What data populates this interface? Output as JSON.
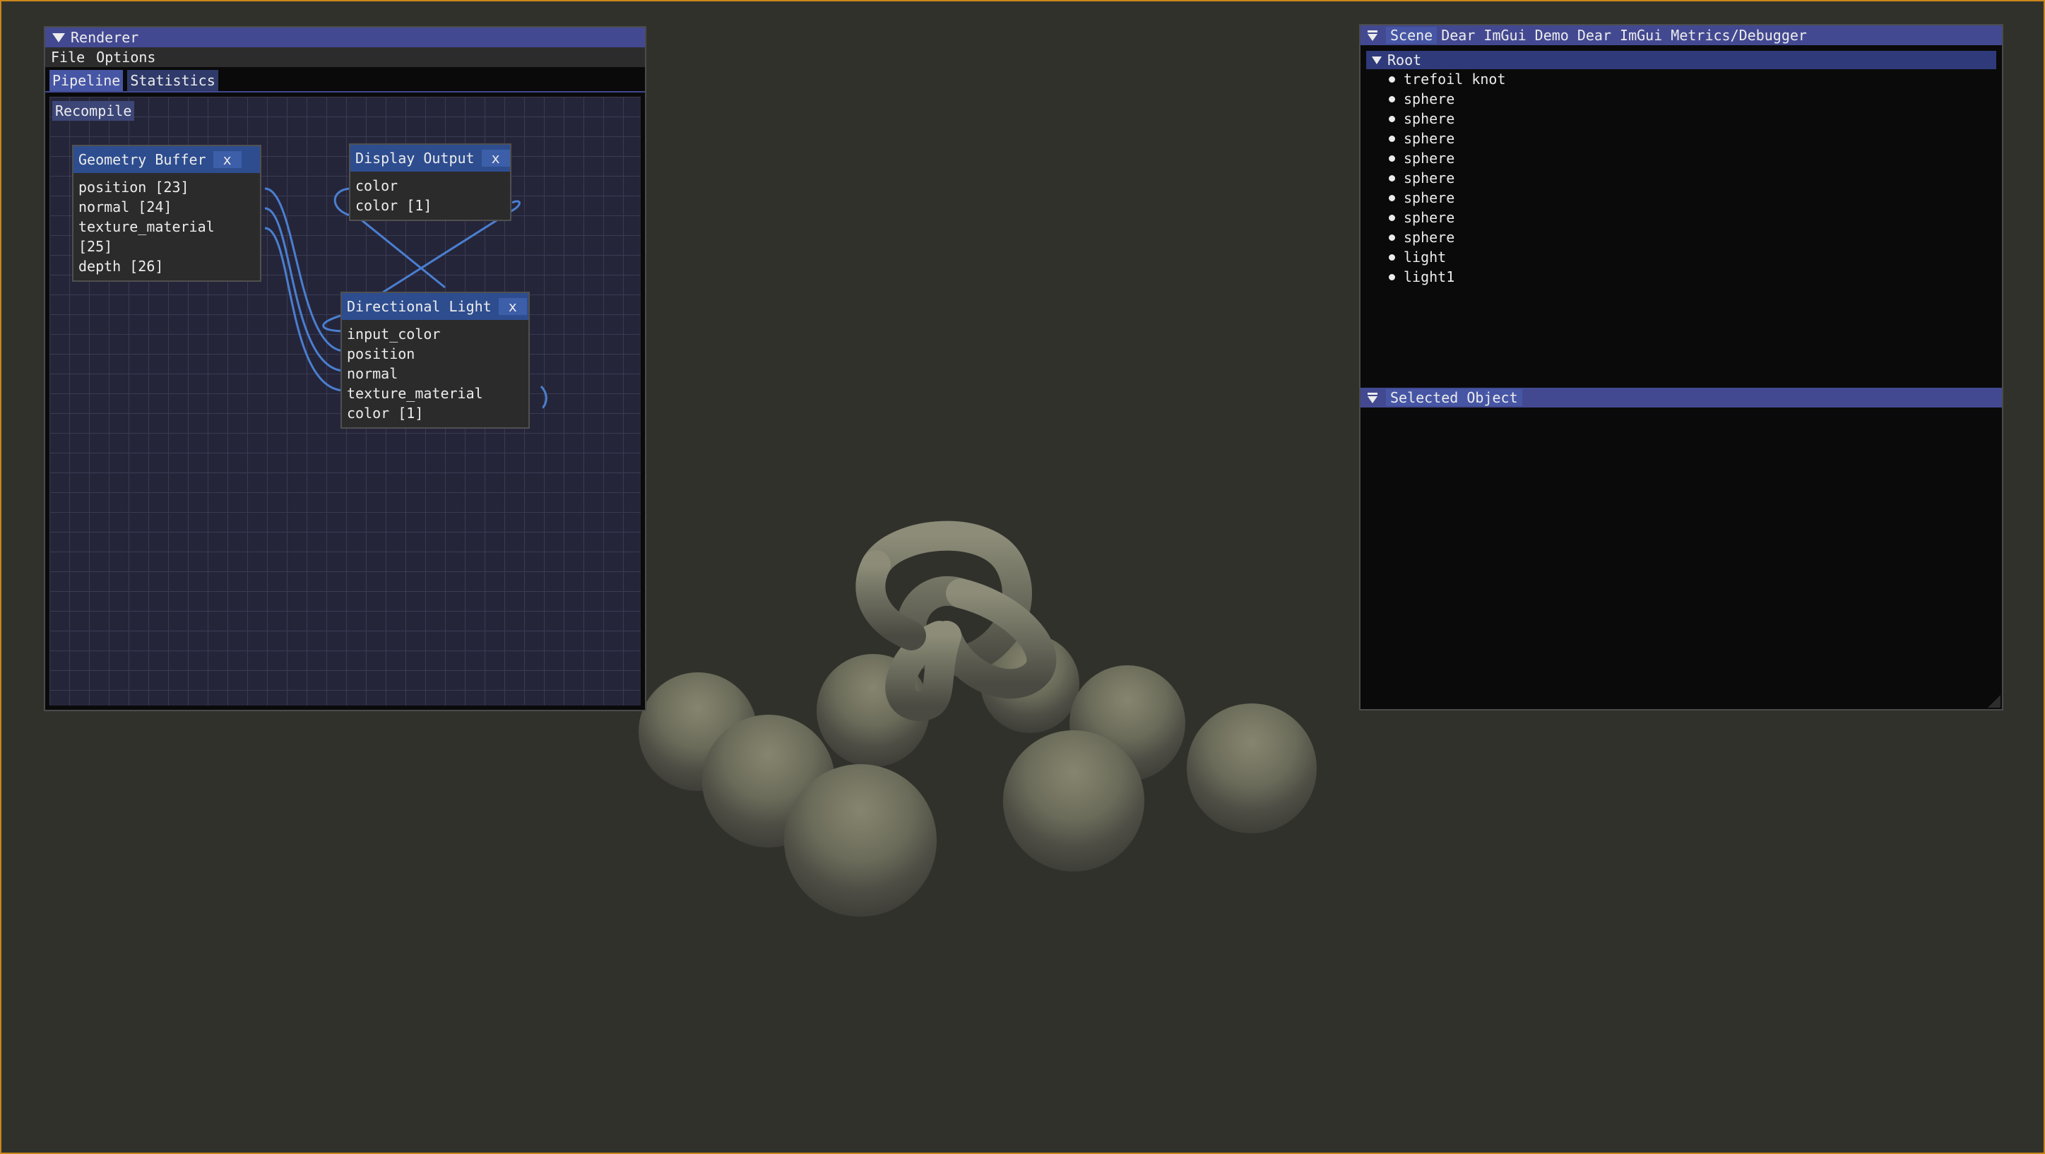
{
  "renderer": {
    "title": "Renderer",
    "menu": [
      "File",
      "Options"
    ],
    "tabs": [
      "Pipeline",
      "Statistics"
    ],
    "recompile": "Recompile",
    "nodes": {
      "geometry": {
        "title": "Geometry Buffer",
        "close": "x",
        "pins": [
          "position [23]",
          "normal [24]",
          "texture_material [25]",
          "depth [26]"
        ]
      },
      "display": {
        "title": "Display Output",
        "close": "x",
        "pins": [
          "color",
          "color [1]"
        ]
      },
      "light": {
        "title": "Directional Light",
        "close": "x",
        "pins": [
          "input_color",
          "position",
          "normal",
          "texture_material",
          "color [1]"
        ]
      }
    },
    "wire_color": "#4a7fd0"
  },
  "scene": {
    "tabs": [
      "Scene",
      "Dear ImGui Demo",
      "Dear ImGui Metrics/Debugger"
    ],
    "root": "Root",
    "items": [
      "trefoil knot",
      "sphere",
      "sphere",
      "sphere",
      "sphere",
      "sphere",
      "sphere",
      "sphere",
      "sphere",
      "light",
      "light1"
    ],
    "selected_title": "Selected Object"
  },
  "colors": {
    "accent": "#434991",
    "frame": "#c8861a",
    "background": "#31312c"
  }
}
